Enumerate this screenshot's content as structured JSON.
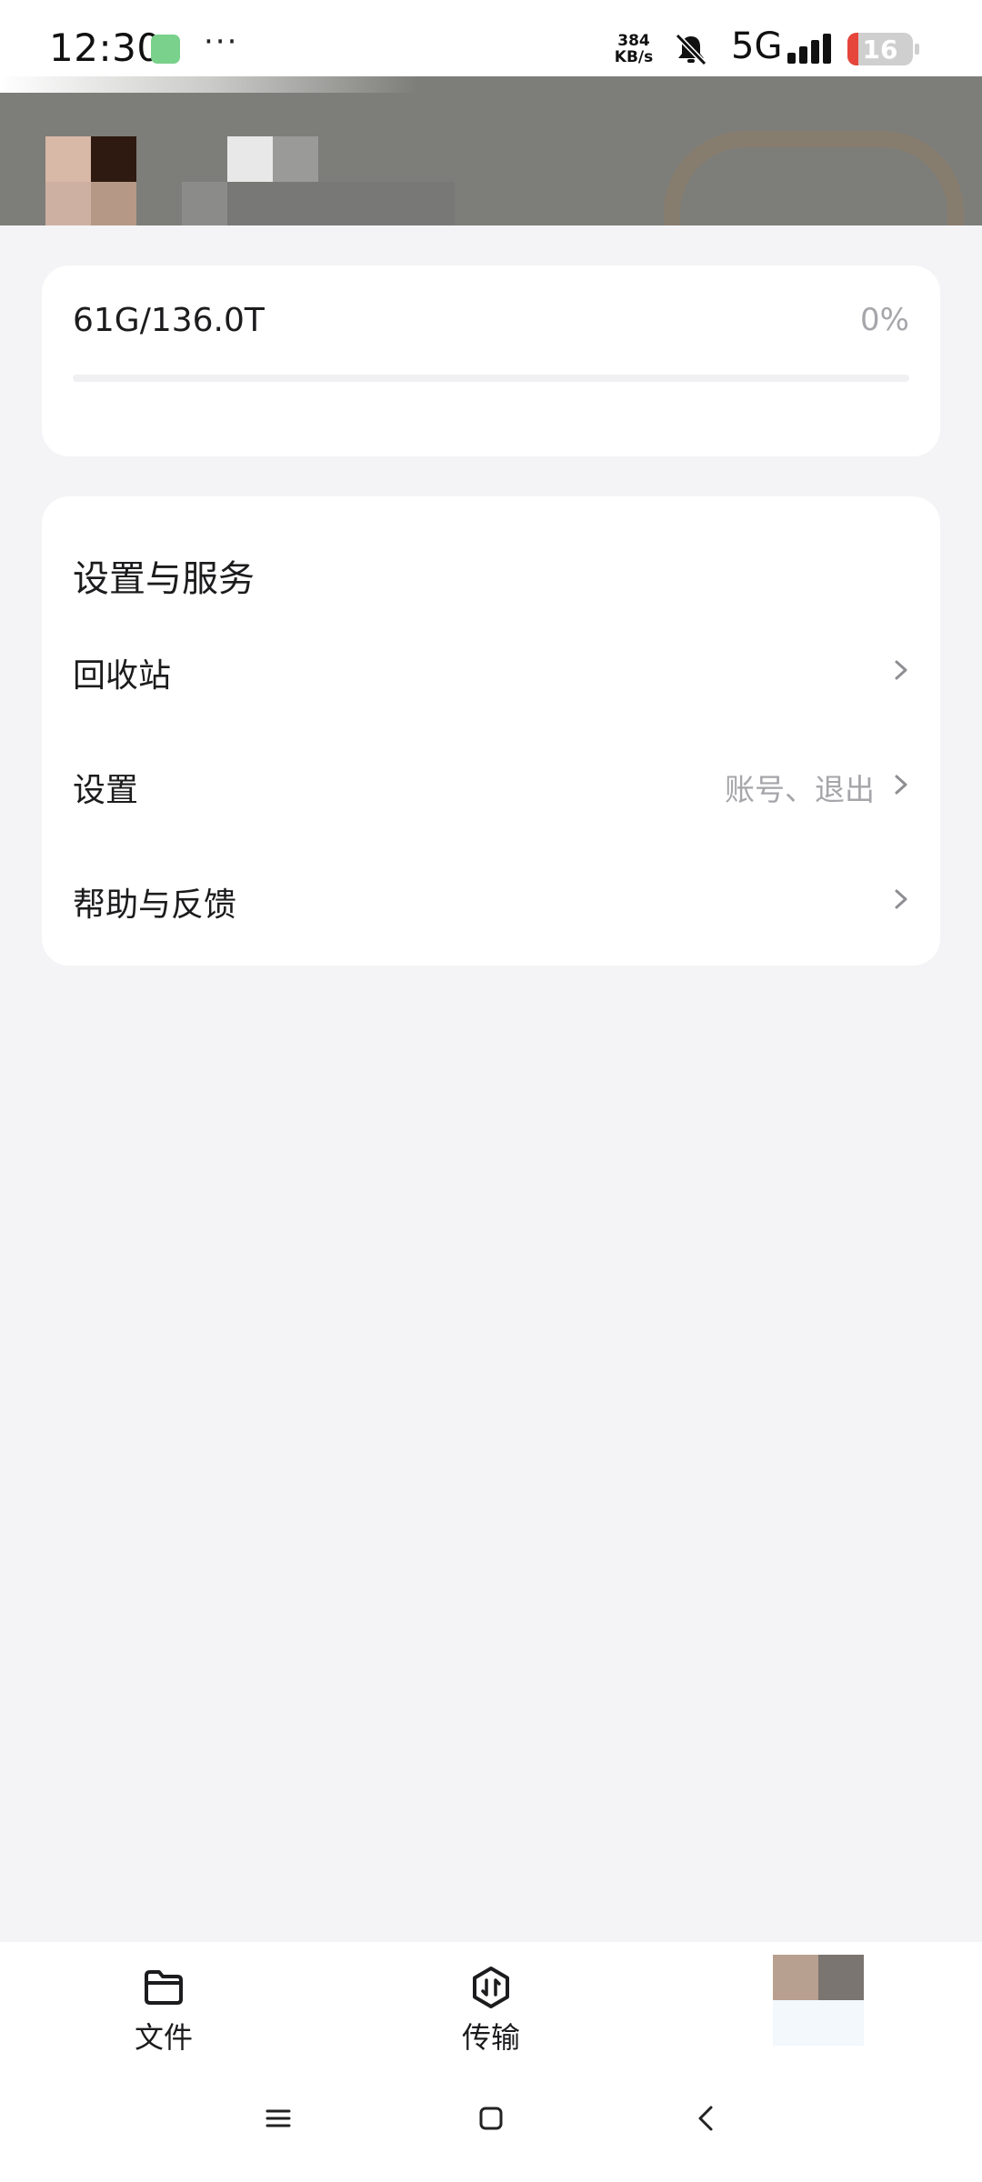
{
  "status_bar": {
    "time": "12:30",
    "dots": "···",
    "net_speed_value": "384",
    "net_speed_unit": "KB/s",
    "network_type": "5G",
    "battery_level": "16",
    "icons": [
      "app-indicator-icon",
      "bell-muted-icon",
      "signal-icon",
      "battery-icon"
    ]
  },
  "storage": {
    "used_label": "61G/136.0T",
    "percent_label": "0%",
    "progress_fraction": 0.0
  },
  "settings": {
    "section_title": "设置与服务",
    "items": [
      {
        "label": "回收站",
        "hint": ""
      },
      {
        "label": "设置",
        "hint": "账号、退出"
      },
      {
        "label": "帮助与反馈",
        "hint": ""
      }
    ]
  },
  "bottom_nav": {
    "items": [
      {
        "label": "文件",
        "icon": "folder-icon"
      },
      {
        "label": "传输",
        "icon": "transfer-icon"
      },
      {
        "label": "",
        "icon": "avatar"
      }
    ]
  },
  "system_nav": {
    "icons": [
      "menu-icon",
      "home-icon",
      "back-icon"
    ]
  },
  "colors": {
    "background": "#f4f4f6",
    "card": "#ffffff",
    "primary_text": "#1c1c1e",
    "secondary_text": "#a6a6aa",
    "battery_low": "#e5453b"
  }
}
